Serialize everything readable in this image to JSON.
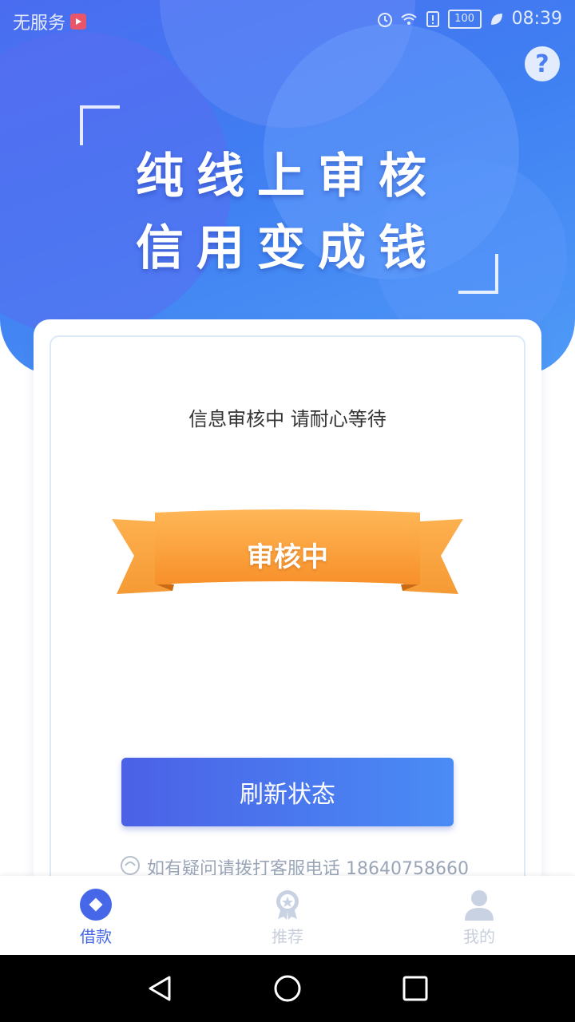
{
  "status_bar": {
    "carrier": "无服务",
    "battery": "100",
    "time": "08:39"
  },
  "hero": {
    "slogan_line1": "纯线上审核",
    "slogan_line2": "信用变成钱",
    "help_label": "?"
  },
  "card": {
    "info_text": "信息审核中  请耐心等待",
    "ribbon_label": "审核中",
    "refresh_label": "刷新状态",
    "contact_text": "如有疑问请拨打客服电话 18640758660"
  },
  "tabs": [
    {
      "label": "借款",
      "icon": "diamond-circle-icon",
      "active": true
    },
    {
      "label": "推荐",
      "icon": "badge-icon",
      "active": false
    },
    {
      "label": "我的",
      "icon": "user-icon",
      "active": false
    }
  ],
  "colors": {
    "primary": "#4667e8",
    "hero_gradient_start": "#4a6cf0",
    "hero_gradient_end": "#4f9bf7",
    "ribbon_orange": "#f7a13a",
    "inactive_tab": "#c8cfdb"
  },
  "nav": {
    "back": "back-triangle-icon",
    "home": "home-circle-icon",
    "recent": "recent-square-icon"
  }
}
